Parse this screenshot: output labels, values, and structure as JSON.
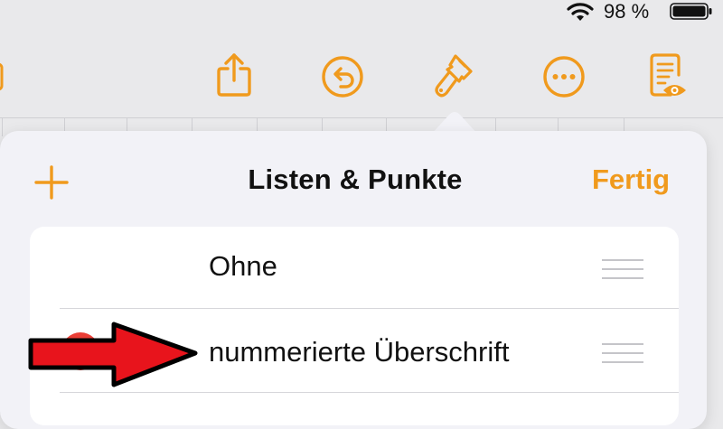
{
  "status_bar": {
    "battery_percent": "98 %",
    "wifi_icon": "wifi-icon",
    "battery_icon": "battery-icon",
    "battery_level": 0.98
  },
  "toolbar": {
    "icons": [
      "share-icon",
      "undo-icon",
      "format-brush-icon",
      "more-icon",
      "reader-view-icon"
    ],
    "accent_color": "#f09a1d"
  },
  "popover": {
    "title": "Listen & Punkte",
    "done_label": "Fertig",
    "add_icon": "plus-icon"
  },
  "list": {
    "items": [
      {
        "label": "Ohne"
      },
      {
        "label": "nummerierte Überschrift"
      }
    ]
  },
  "annotation": {
    "arrow_color": "#e8141c",
    "dot_color": "#ea3e36"
  }
}
